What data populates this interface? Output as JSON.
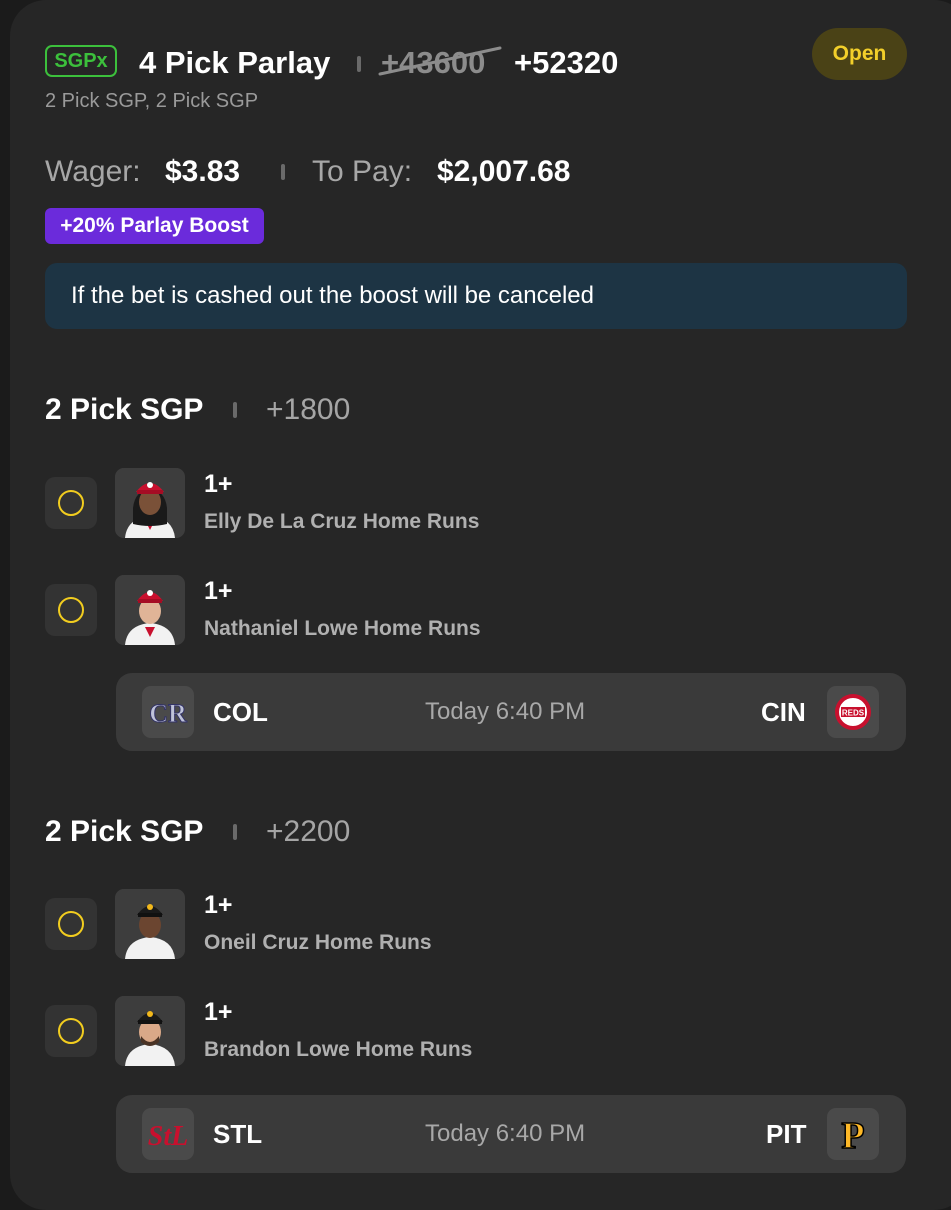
{
  "header": {
    "badge": "SGPx",
    "title": "4 Pick Parlay",
    "old_odds": "+43600",
    "new_odds": "+52320",
    "subtitle": "2 Pick SGP, 2 Pick SGP",
    "status": "Open"
  },
  "wager": {
    "label": "Wager:",
    "value": "$3.83"
  },
  "payout": {
    "label": "To Pay:",
    "value": "$2,007.68"
  },
  "boost_badge": "+20% Parlay Boost",
  "notice": "If the bet is cashed out the boost will be canceled",
  "sections": [
    {
      "title": "2 Pick SGP",
      "odds": "+1800",
      "picks": [
        {
          "line": "1+",
          "desc": "Elly De La Cruz Home Runs"
        },
        {
          "line": "1+",
          "desc": "Nathaniel Lowe Home Runs"
        }
      ],
      "game": {
        "away": "COL",
        "home": "CIN",
        "time": "Today 6:40 PM"
      }
    },
    {
      "title": "2 Pick SGP",
      "odds": "+2200",
      "picks": [
        {
          "line": "1+",
          "desc": "Oneil Cruz Home Runs"
        },
        {
          "line": "1+",
          "desc": "Brandon Lowe Home Runs"
        }
      ],
      "game": {
        "away": "STL",
        "home": "PIT",
        "time": "Today 6:40 PM"
      }
    }
  ],
  "colors": {
    "background": "#262626",
    "accent_yellow": "#f2cd1f",
    "sgpx_green": "#3cc03c",
    "boost_purple": "#6b2bdb",
    "notice_blue": "#1d3444"
  }
}
